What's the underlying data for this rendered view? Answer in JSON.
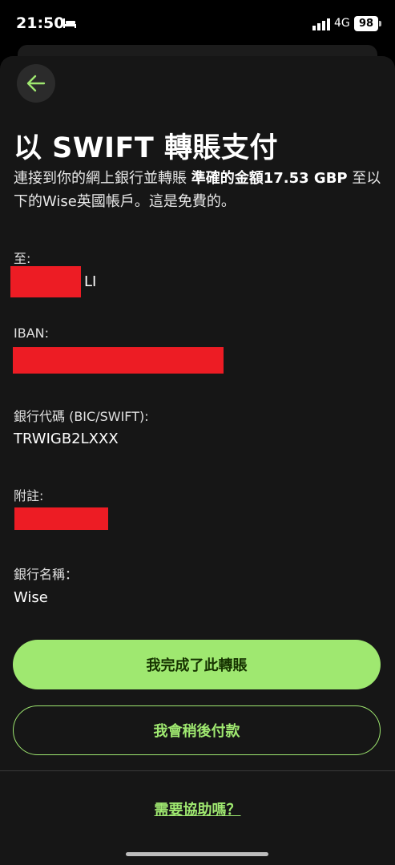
{
  "status_bar": {
    "time": "21:50",
    "network": "4G",
    "battery": "98",
    "icons": [
      "bed-icon",
      "signal-icon"
    ]
  },
  "header": {
    "back_icon": "arrow-left-icon",
    "title": "以 SWIFT 轉賬支付"
  },
  "instruction": {
    "prefix": "連接到你的網上銀行並轉賬 ",
    "amount": "準確的金額17.53 GBP",
    "suffix": " 至以下的Wise英國帳戶。這是免費的。"
  },
  "fields": {
    "recipient": {
      "label": "至:",
      "value_visible": "LI"
    },
    "iban": {
      "label": "IBAN:"
    },
    "bic": {
      "label": "銀行代碼 (BIC/SWIFT):",
      "value": "TRWIGB2LXXX"
    },
    "reference": {
      "label": "附註:"
    },
    "bank_name": {
      "label": "銀行名稱：",
      "value": "Wise"
    }
  },
  "actions": {
    "primary_label": "我完成了此轉賬",
    "secondary_label": "我會稍後付款",
    "help_label": "需要協助嗎？"
  },
  "colors": {
    "accent": "#9fe870",
    "accent_text": "#163300",
    "sheet": "#161616",
    "redaction": "#ed1c24"
  }
}
